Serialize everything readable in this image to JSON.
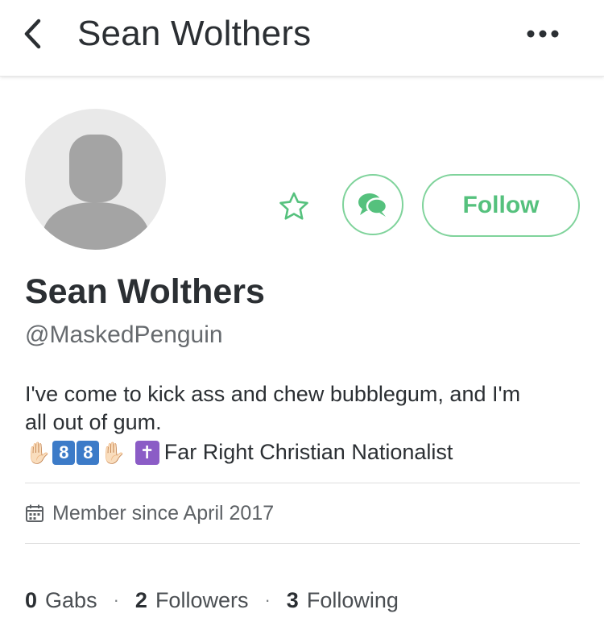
{
  "header": {
    "title": "Sean Wolthers",
    "back_icon": "chevron-left-icon",
    "more_icon": "more-horizontal-icon"
  },
  "profile": {
    "avatar_icon": "default-avatar-icon",
    "display_name": "Sean Wolthers",
    "handle": "@MaskedPenguin",
    "bio_line1": "I've come to kick ass and chew bubblegum, and I'm",
    "bio_line2": "all out of gum.",
    "bio_emoji_hand": "✋🏻",
    "bio_digit1": "8",
    "bio_digit2": "8",
    "bio_cross": "✝",
    "bio_line3_text": "Far Right Christian Nationalist",
    "member_since": "Member since April 2017"
  },
  "actions": {
    "star_icon": "star-icon",
    "chat_icon": "chat-bubbles-icon",
    "follow_label": "Follow"
  },
  "stats": {
    "gabs_count": "0",
    "gabs_label": "Gabs",
    "followers_count": "2",
    "followers_label": "Followers",
    "following_count": "3",
    "following_label": "Following",
    "separator": "·"
  },
  "colors": {
    "accent": "#55c17d",
    "accent_border": "#7fd39b",
    "text": "#2b2f33",
    "muted": "#666a6e",
    "avatar_bg": "#e9e9e9",
    "avatar_figure": "#a4a4a4",
    "digit_tile": "#3c7bc8",
    "cross_tile": "#8b5cc6"
  }
}
